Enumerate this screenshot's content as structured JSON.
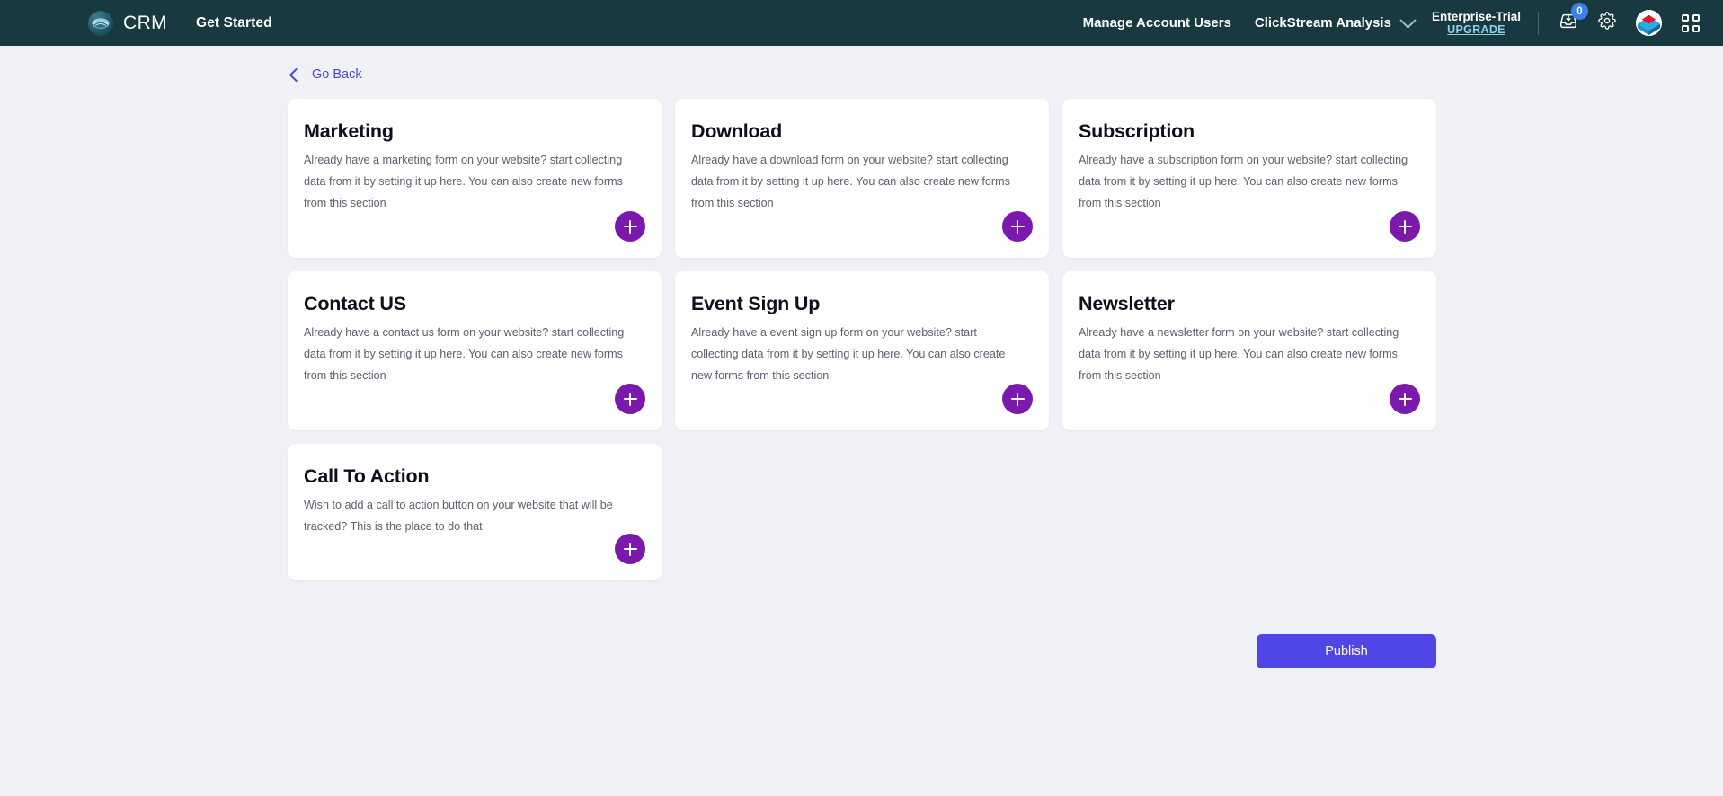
{
  "header": {
    "brand_name": "CRM",
    "logo_icon": "cloud-logo-icon",
    "get_started_label": "Get Started",
    "manage_users_label": "Manage Account Users",
    "clickstream_label": "ClickStream Analysis",
    "clickstream_chevron_icon": "chevron-down-icon",
    "plan_name": "Enterprise-Trial",
    "upgrade_label": "UPGRADE",
    "inbox_icon": "inbox-download-icon",
    "inbox_badge_count": "0",
    "settings_icon": "gear-icon",
    "account_avatar_icon": "account-avatar-icon",
    "apps_icon": "apps-grid-icon",
    "background_color": "#17393f",
    "badge_color": "#3b82e8",
    "upgrade_link_color": "#8fd2e8"
  },
  "page": {
    "background_color": "#f0f1f6",
    "go_back_label": "Go Back",
    "go_back_icon": "chevron-left-icon",
    "go_back_color": "#4f46c8",
    "accent_add_color": "#7b19ad",
    "publish_color": "#4f46e5"
  },
  "cards": [
    {
      "title": "Marketing",
      "description": "Already have a marketing form on your website? start collecting data from it by setting it up here. You can also create new forms from this section",
      "add_icon": "plus-icon"
    },
    {
      "title": "Download",
      "description": "Already have a download form on your website? start collecting data from it by setting it up here. You can also create new forms from this section",
      "add_icon": "plus-icon"
    },
    {
      "title": "Subscription",
      "description": "Already have a subscription form on your website? start collecting data from it by setting it up here. You can also create new forms from this section",
      "add_icon": "plus-icon"
    },
    {
      "title": "Contact US",
      "description": "Already have a contact us form on your website? start collecting data from it by setting it up here. You can also create new forms from this section",
      "add_icon": "plus-icon"
    },
    {
      "title": "Event Sign Up",
      "description": "Already have a event sign up form on your website? start collecting data from it by setting it up here. You can also create new forms from this section",
      "add_icon": "plus-icon"
    },
    {
      "title": "Newsletter",
      "description": "Already have a newsletter form on your website? start collecting data from it by setting it up here. You can also create new forms from this section",
      "add_icon": "plus-icon"
    },
    {
      "title": "Call To Action",
      "description": "Wish to add a call to action button on your website that will be tracked? This is the place to do that",
      "add_icon": "plus-icon"
    }
  ],
  "footer": {
    "publish_label": "Publish"
  }
}
